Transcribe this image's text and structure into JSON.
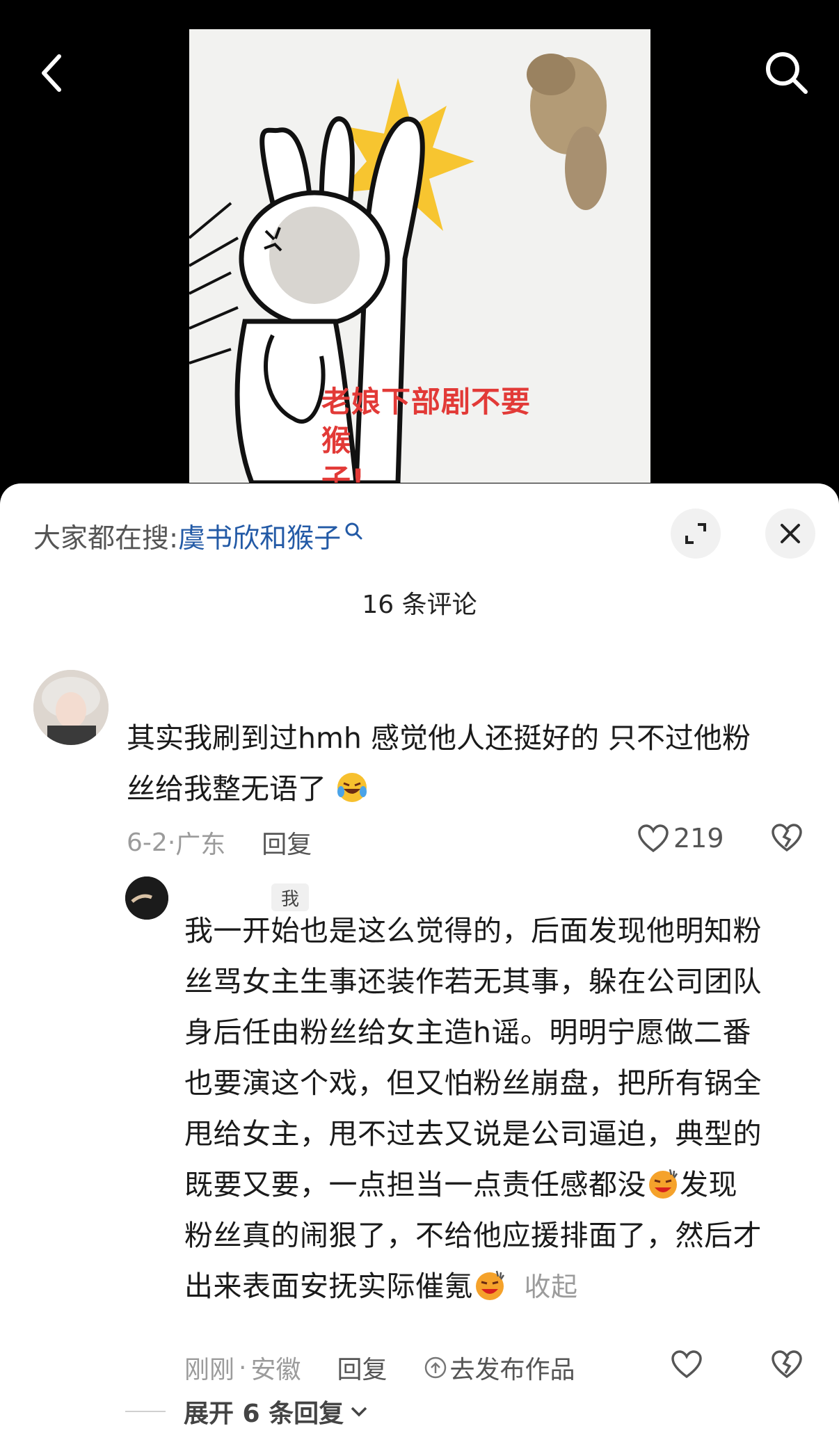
{
  "nav": {
    "back_icon": "chevron-left-icon",
    "search_icon": "search-icon"
  },
  "meme": {
    "caption_line1": "老娘下部剧不要猴",
    "caption_line2": "子!"
  },
  "sheet": {
    "hot_search_label": "大家都在搜:",
    "hot_search_query": "虞书欣和猴子",
    "comment_count": "16 条评论"
  },
  "comment": {
    "text_line1": "其实我刷到过hmh 感觉他人还挺好的 只不过他粉",
    "text_line2": "丝给我整无语了",
    "date": "6-2",
    "location": "广东",
    "reply_label": "回复",
    "likes": "219"
  },
  "reply": {
    "badge": "我",
    "lines": [
      "我一开始也是这么觉得的，后面发现他明知粉",
      "丝骂女主生事还装作若无其事，躲在公司团队",
      "身后任由粉丝给女主造h谣。明明宁愿做二番",
      "也要演这个戏，但又怕粉丝崩盘，把所有锅全",
      "甩给女主，甩不过去又说是公司逼迫，典型的",
      "既要又要，一点担当一点责任感都没",
      "发现",
      "粉丝真的闹狠了，不给他应援排面了，然后才",
      "出来表面安抚实际催氪"
    ],
    "collapse_label": "收起",
    "time": "刚刚",
    "location": "安徽",
    "reply_label": "回复",
    "publish_label": "去发布作品"
  },
  "expand_replies": "展开 6 条回复",
  "colors": {
    "accent_link": "#235aa6",
    "caption_red": "#e23a37",
    "sheet_bg": "#ffffff"
  }
}
